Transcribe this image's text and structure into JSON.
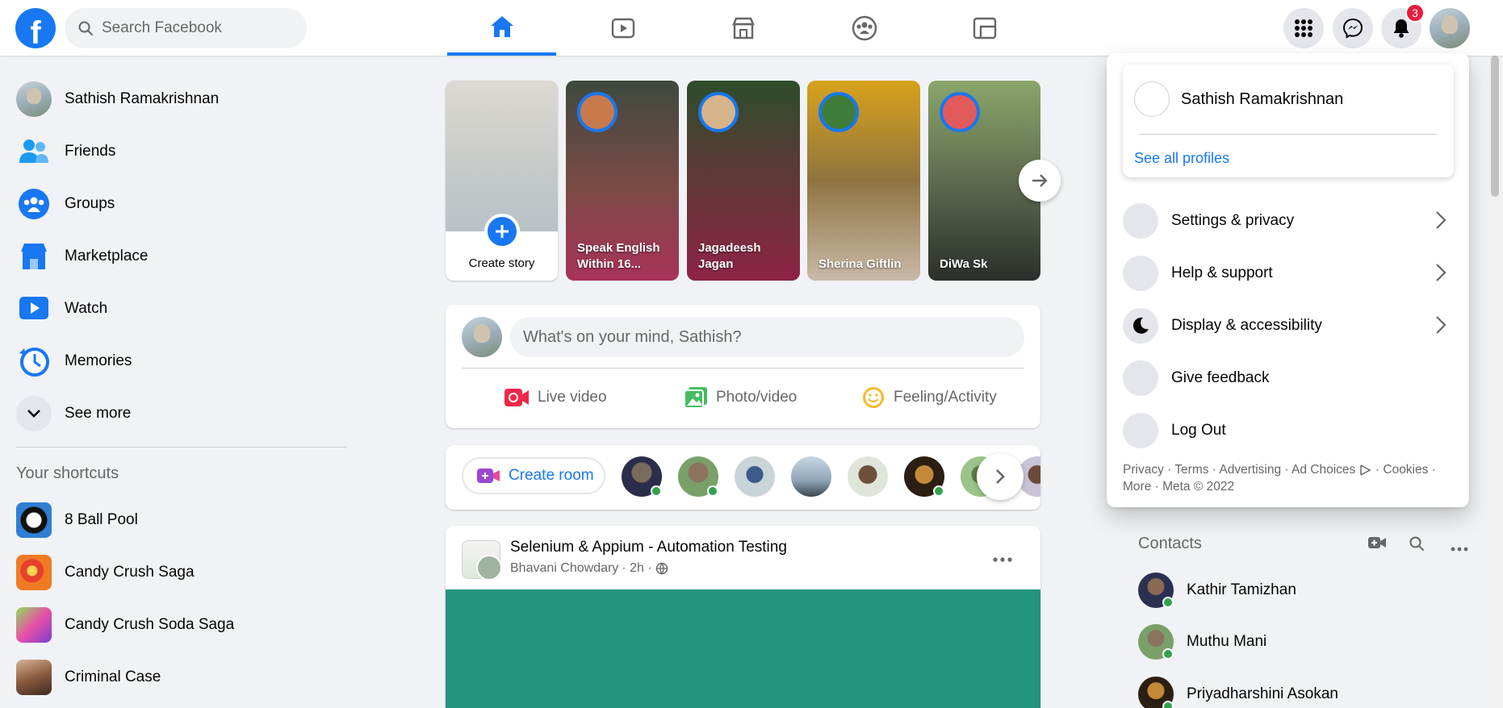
{
  "topbar": {
    "logo": "f",
    "search_placeholder": "Search Facebook",
    "nav_tabs": [
      "home-icon",
      "watch-icon",
      "marketplace-icon",
      "groups-icon",
      "gaming-icon"
    ],
    "notification_count": "3"
  },
  "sidebar": {
    "profile_name": "Sathish Ramakrishnan",
    "items": [
      {
        "label": "Friends",
        "icon": "friends-icon"
      },
      {
        "label": "Groups",
        "icon": "groups-icon"
      },
      {
        "label": "Marketplace",
        "icon": "marketplace-icon"
      },
      {
        "label": "Watch",
        "icon": "watch-icon"
      },
      {
        "label": "Memories",
        "icon": "memories-icon"
      },
      {
        "label": "See more",
        "icon": "chevron-down-icon"
      }
    ],
    "shortcuts_title": "Your shortcuts",
    "shortcuts": [
      "8 Ball Pool",
      "Candy Crush Saga",
      "Candy Crush Soda Saga",
      "Criminal Case"
    ]
  },
  "stories": {
    "create_label": "Create story",
    "items": [
      {
        "name": "Speak English Within 16..."
      },
      {
        "name": "Jagadeesh Jagan"
      },
      {
        "name": "Sherina Giftlin"
      },
      {
        "name": "DiWa Sk"
      }
    ]
  },
  "composer": {
    "placeholder": "What's on your mind, Sathish?",
    "live_video": "Live video",
    "photo_video": "Photo/video",
    "feeling": "Feeling/Activity"
  },
  "rooms": {
    "create_room": "Create room"
  },
  "post": {
    "group": "Selenium & Appium - Automation Testing",
    "author": "Bhavani Chowdary",
    "meta": "· 2h ·"
  },
  "dropdown": {
    "profile_name": "Sathish Ramakrishnan",
    "see_all": "See all profiles",
    "menu": [
      {
        "label": "Settings & privacy"
      },
      {
        "label": "Help & support"
      },
      {
        "label": "Display & accessibility"
      },
      {
        "label": "Give feedback"
      },
      {
        "label": "Log Out"
      }
    ],
    "legal_line1": "Privacy · Terms · Advertising · Ad Choices",
    "legal_cookies": "· Cookies ·",
    "legal_line2": "More · Meta © 2022"
  },
  "contacts": {
    "title": "Contacts",
    "people": [
      "Kathir Tamizhan",
      "Muthu Mani",
      "Priyadharshini Asokan"
    ]
  },
  "colors": {
    "brand": "#1877f2",
    "background": "#f0f2f5",
    "online": "#31a24c",
    "notification": "#e41e3f"
  }
}
